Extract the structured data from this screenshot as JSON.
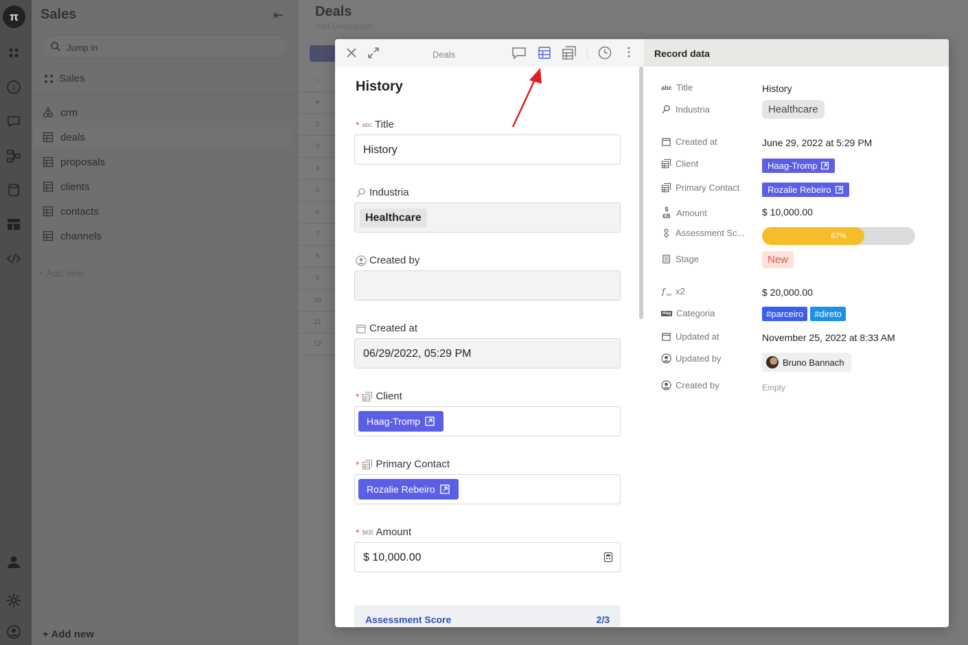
{
  "sidebar": {
    "title": "Sales",
    "search_placeholder": "Jump in",
    "section": "Sales",
    "items": [
      {
        "label": "crm"
      },
      {
        "label": "deals"
      },
      {
        "label": "proposals"
      },
      {
        "label": "clients"
      },
      {
        "label": "contacts"
      },
      {
        "label": "channels"
      }
    ],
    "add_new": "Add new",
    "add_new_bottom": "Add new"
  },
  "main": {
    "title": "Deals",
    "description": "Add Description",
    "row_numbers": [
      "2",
      "3",
      "4",
      "5",
      "6",
      "7",
      "8",
      "9",
      "10",
      "11",
      "12"
    ]
  },
  "modal": {
    "toolbar_title": "Deals",
    "form": {
      "heading": "History",
      "fields": {
        "title": {
          "label": "Title",
          "type_icon": "abc",
          "value": "History"
        },
        "industria": {
          "label": "Industria",
          "value": "Healthcare"
        },
        "created_by": {
          "label": "Created by",
          "value": ""
        },
        "created_at": {
          "label": "Created at",
          "value": "06/29/2022, 05:29 PM"
        },
        "client": {
          "label": "Client",
          "value": "Haag-Tromp"
        },
        "primary_contact": {
          "label": "Primary Contact",
          "value": "Rozalie Rebeiro"
        },
        "amount": {
          "label": "Amount",
          "type_icon": "$€B",
          "value": "$ 10,000.00"
        }
      },
      "assessment": {
        "label": "Assessment Score",
        "count": "2/3"
      }
    },
    "record": {
      "header": "Record data",
      "rows": {
        "title": {
          "label": "Title",
          "icon": "abc",
          "value": "History"
        },
        "industria": {
          "label": "Industria",
          "value": "Healthcare"
        },
        "created_at": {
          "label": "Created at",
          "value": "June 29, 2022 at 5:29 PM"
        },
        "client": {
          "label": "Client",
          "value": "Haag-Tromp"
        },
        "primary_contact": {
          "label": "Primary Contact",
          "value": "Rozalie Rebeiro"
        },
        "amount": {
          "label": "Amount",
          "icon": "$€B",
          "value": "$ 10,000.00"
        },
        "assessment": {
          "label": "Assessment Sc...",
          "value": "67%",
          "fraction": 0.67
        },
        "stage": {
          "label": "Stage",
          "value": "New"
        },
        "x2": {
          "label": "x2",
          "value": "$ 20,000.00"
        },
        "categoria": {
          "label": "Categoria",
          "icon": "#tag",
          "values": [
            "#parceiro",
            "#direto"
          ]
        },
        "updated_at": {
          "label": "Updated at",
          "value": "November 25, 2022 at 8:33 AM"
        },
        "updated_by": {
          "label": "Updated by",
          "value": "Bruno Bannach"
        },
        "created_by": {
          "label": "Created by",
          "value": "Empty"
        }
      }
    }
  },
  "colors": {
    "accent": "#5b5fe6",
    "progress": "#f5bd2a",
    "stage_new_bg": "#fde2dc",
    "stage_new_fg": "#e2573e",
    "tag_parceiro": "#3b5fe8",
    "tag_direto": "#1e90e6",
    "annotation_arrow": "#e02020"
  }
}
